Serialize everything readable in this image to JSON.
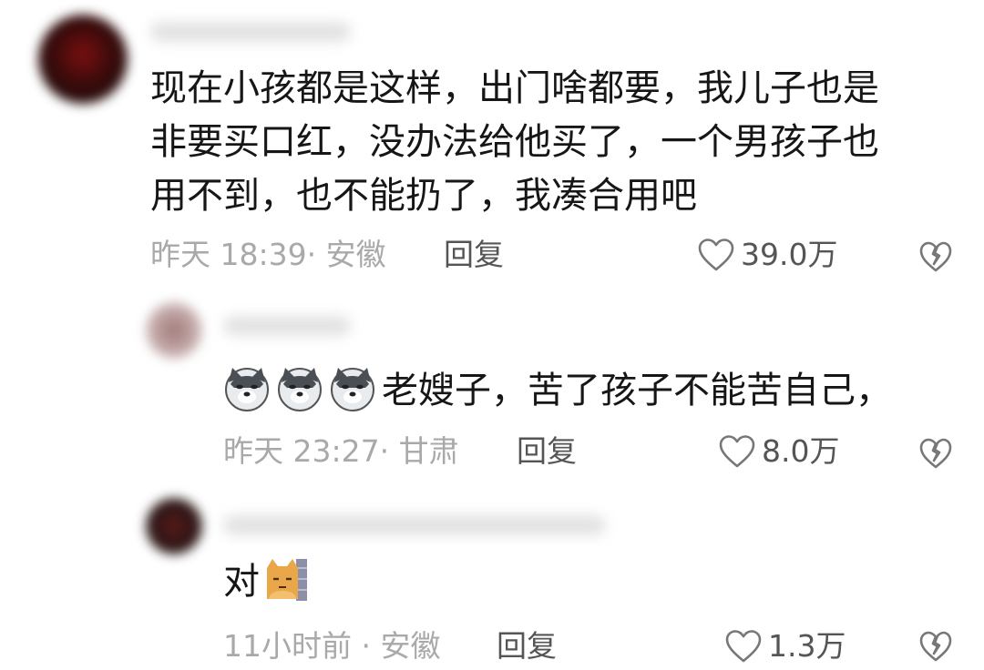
{
  "comments": [
    {
      "lines": [
        "现在小孩都是这样，出门啥都要，我儿子也是",
        "非要买口红，没办法给他买了，一个男孩子也",
        "用不到，也不能扔了，我凑合用吧"
      ],
      "meta": "昨天 18:39· 安徽",
      "reply": "回复",
      "likes": "39.0万",
      "avatar_color": "#3a0a0a"
    },
    {
      "text": "老嫂子，苦了孩子不能苦自己，",
      "emoji": [
        "doge-icon",
        "doge-icon",
        "doge-icon"
      ],
      "meta": "昨天 23:27· 甘肃",
      "reply": "回复",
      "likes": "8.0万",
      "avatar_color": "#b89a9a"
    },
    {
      "text": "对",
      "emoji": [
        "cat-icon"
      ],
      "meta": "11小时前 · 安徽",
      "reply": "回复",
      "likes": "1.3万",
      "avatar_color": "#2b1414"
    }
  ]
}
